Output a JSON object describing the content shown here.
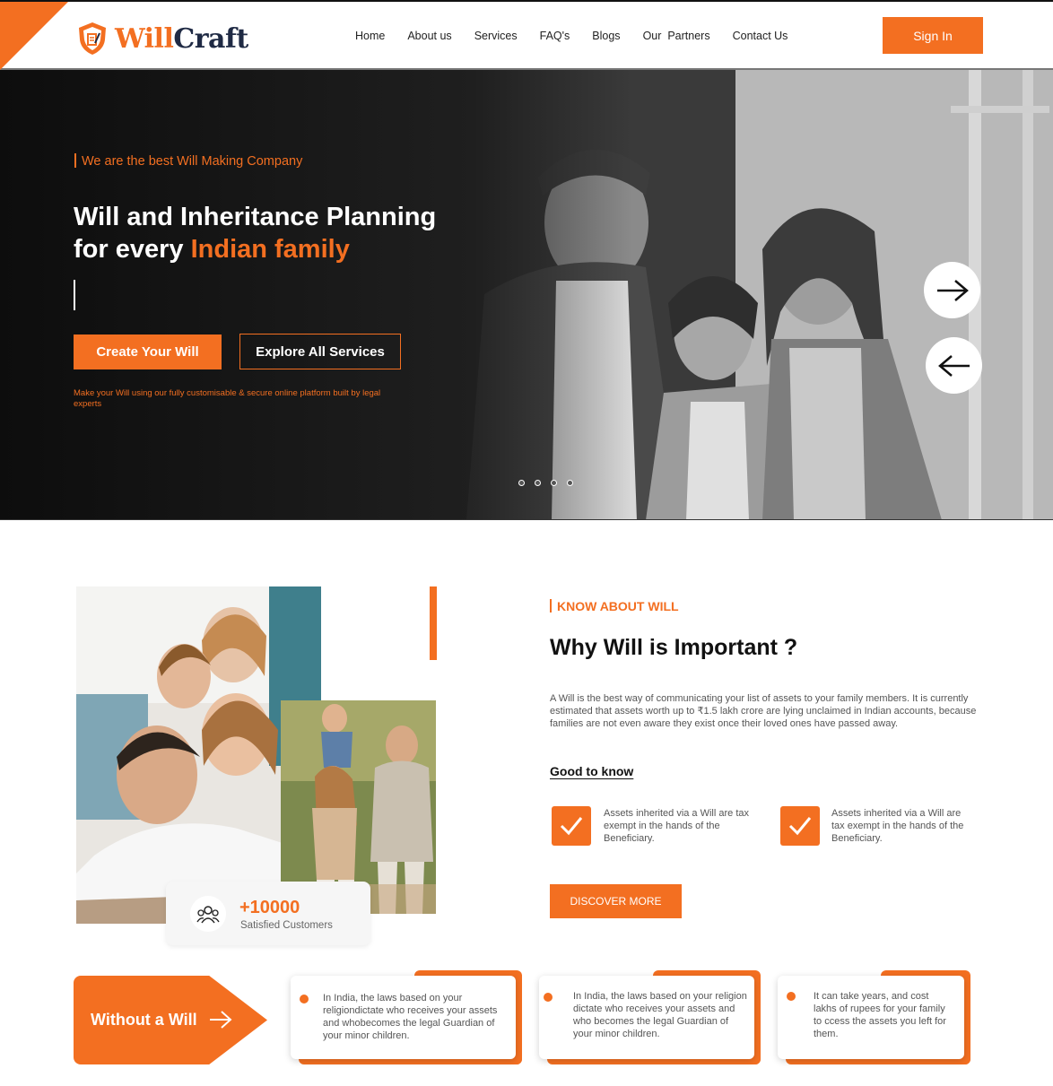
{
  "header": {
    "logo_word_1": "Will",
    "logo_word_2": "Craft",
    "nav": [
      "Home",
      "About us",
      "Services",
      "FAQ's",
      "Blogs",
      "Our  Partners",
      "Contact Us"
    ],
    "signin_label": "Sign In"
  },
  "hero": {
    "tagline": "We are the best Will Making Company",
    "title_line_1": "Will and Inheritance Planning",
    "title_line_2_plain": "for every ",
    "title_line_2_accent": "Indian family",
    "create_label": "Create Your Will",
    "explore_label": "Explore All Services",
    "note": "Make your Will using our fully customisable & secure online platform built by legal experts",
    "slides": 4
  },
  "about": {
    "kicker": "KNOW ABOUT WILL",
    "title": "Why Will is Important ?",
    "body": "A Will is the best way of communicating your list of assets to your family members. It is currently estimated that assets worth up to ₹1.5 lakh crore are lying unclaimed in Indian accounts, because families are not even aware they exist once their loved  ones have passed away.",
    "good_to_know": "Good to know",
    "points": [
      "Assets inherited via a Will are tax exempt in the hands of the Beneficiary.",
      "Assets inherited via a Will are tax exempt in the hands of the Beneficiary."
    ],
    "discover_label": "DISCOVER MORE",
    "stat_number": "+10000",
    "stat_label": "Satisfied Customers"
  },
  "without_will": {
    "label": "Without a Will",
    "cards": [
      "In India, the laws based on your religiondictate who receives your assets and whobecomes the legal Guardian of your minor children.",
      "In India, the laws based on your religion dictate who receives your assets and who becomes the legal Guardian of your minor children.",
      "It can take years, and cost lakhs of rupees for your family to ccess the assets you left for them."
    ]
  },
  "colors": {
    "accent": "#f36f21",
    "navy": "#1f2a44"
  },
  "icons": [
    "shield-logo-icon",
    "arrow-right-icon",
    "arrow-left-icon",
    "users-icon",
    "checkmark-icon"
  ]
}
